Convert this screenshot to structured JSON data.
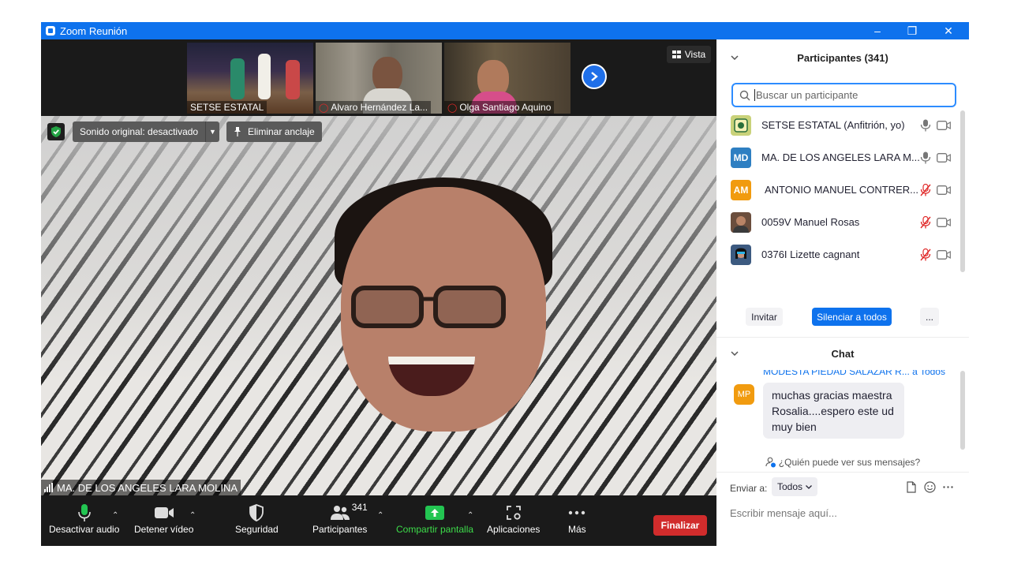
{
  "window": {
    "title": "Zoom Reunión"
  },
  "colors": {
    "titlebar": "#0e72ed",
    "accent": "#2d8cff",
    "end": "#d12c2c",
    "share": "#3ddc4a",
    "mute": "#e02828"
  },
  "strip": {
    "thumbnails": [
      {
        "name": "SETSE ESTATAL",
        "muted": false
      },
      {
        "name": "Alvaro Hernández La...",
        "muted": true
      },
      {
        "name": "Olga Santiago Aquino",
        "muted": true
      }
    ],
    "view_label": "Vista"
  },
  "video": {
    "sound_label": "Sonido original: desactivado",
    "unpin_label": "Eliminar anclaje",
    "speaker_name": "MA. DE LOS ANGELES LARA MOLINA"
  },
  "toolbar": {
    "audio_label": "Desactivar audio",
    "video_label": "Detener vídeo",
    "security_label": "Seguridad",
    "participants_label": "Participantes",
    "participants_count": "341",
    "share_label": "Compartir pantalla",
    "apps_label": "Aplicaciones",
    "more_label": "Más",
    "end_label": "Finalizar"
  },
  "participants": {
    "header": "Participantes (341)",
    "search_placeholder": "Buscar un participante",
    "list": [
      {
        "name": "SETSE ESTATAL (Anfitrión, yo)",
        "initials": "",
        "avatar_color": "#c9d27a",
        "muted": false
      },
      {
        "name": "MA. DE LOS ANGELES LARA M...",
        "initials": "MD",
        "avatar_color": "#2e7fc2",
        "muted": false
      },
      {
        "name": "ANTONIO MANUEL CONTRER...",
        "initials": "AM",
        "avatar_color": "#f19b0f",
        "muted": true
      },
      {
        "name": "0059V Manuel Rosas",
        "initials": "",
        "avatar_color": "#6b4e3d",
        "muted": true
      },
      {
        "name": "0376I Lizette cagnant",
        "initials": "",
        "avatar_color": "#3c5a80",
        "muted": true
      }
    ],
    "invite_label": "Invitar",
    "mute_all_label": "Silenciar a todos",
    "more_label": "..."
  },
  "chat": {
    "header": "Chat",
    "message": {
      "from": "MODESTA PIEDAD SALAZAR R...",
      "to": "a Todos",
      "initials": "MP",
      "text": "muchas gracias maestra Rosalia....espero este ud muy bien"
    },
    "who_sees": "¿Quién puede ver sus mensajes?",
    "send_to_label": "Enviar a:",
    "send_to_value": "Todos",
    "input_placeholder": "Escribir mensaje aquí..."
  }
}
